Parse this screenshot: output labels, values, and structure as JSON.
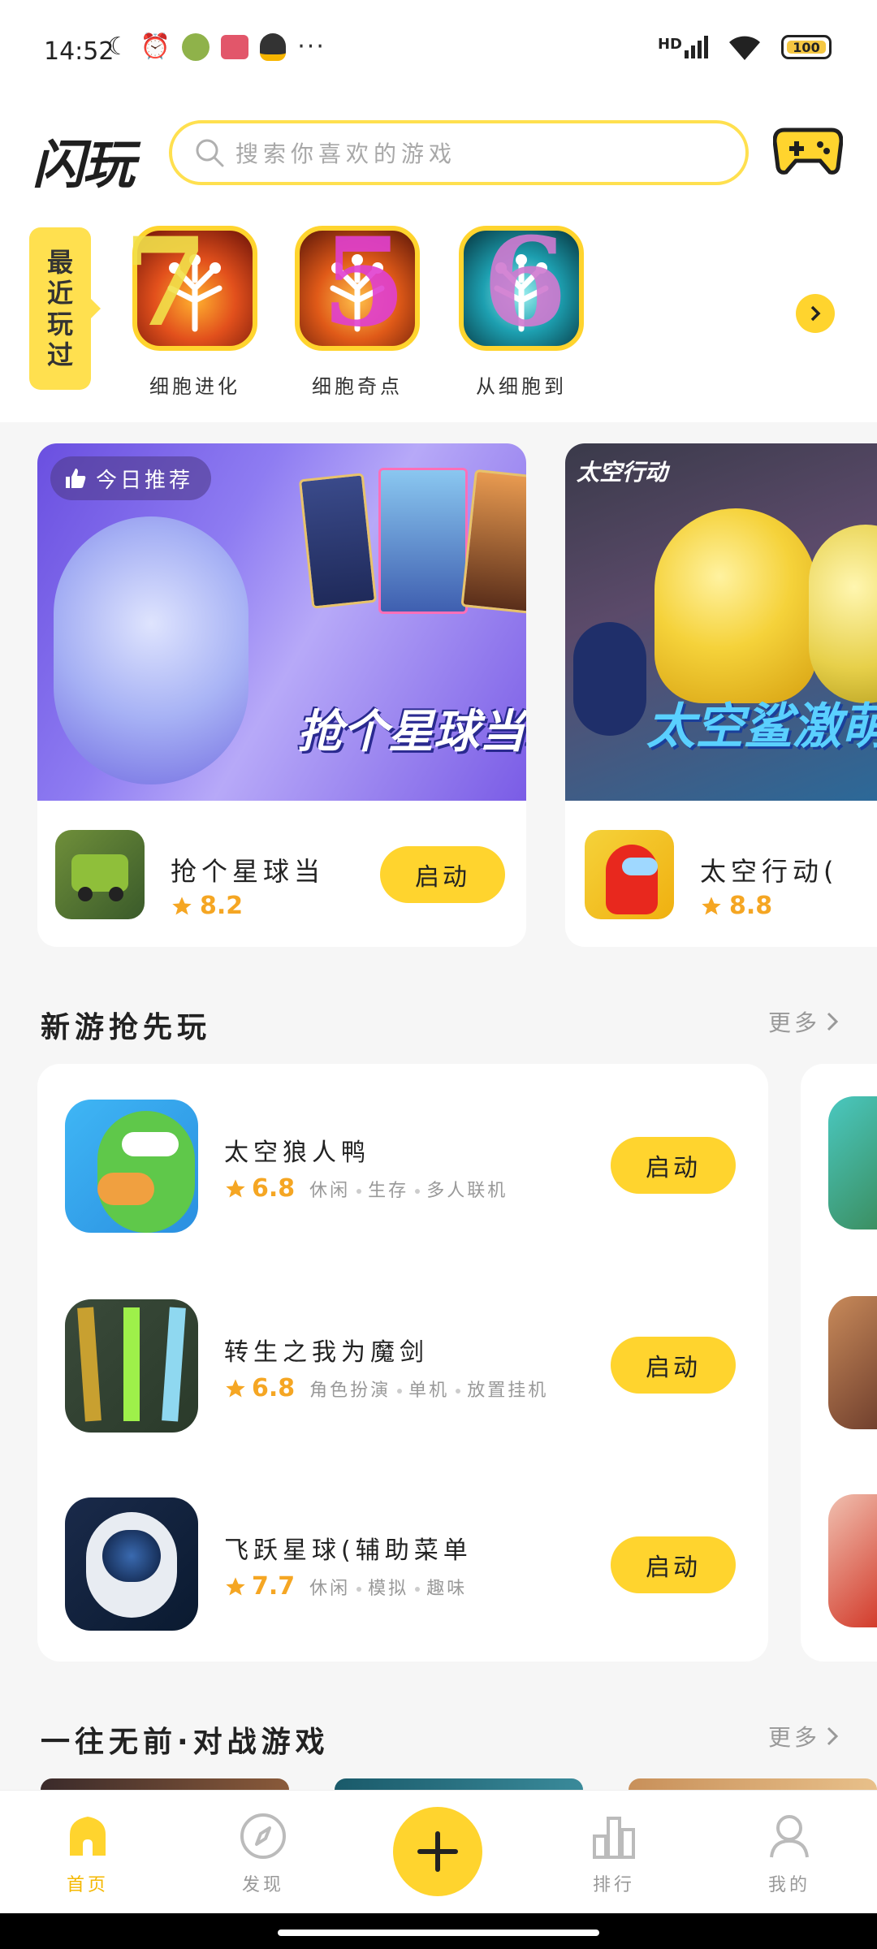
{
  "status_bar": {
    "time": "14:52",
    "hd": "HD",
    "dots": "···",
    "battery": "100"
  },
  "header": {
    "logo": "闪玩",
    "search_placeholder": "搜索你喜欢的游戏"
  },
  "recent": {
    "tag": [
      "最",
      "近",
      "玩",
      "过"
    ],
    "items": [
      {
        "name": "细胞进化",
        "number": "7"
      },
      {
        "name": "细胞奇点",
        "number": "5"
      },
      {
        "name": "从细胞到",
        "number": "6"
      }
    ]
  },
  "banners": [
    {
      "tag": "今日推荐",
      "overlay": "抢个星球当霸主",
      "title": "抢个星球当",
      "rating": "8.2",
      "button": "启动"
    },
    {
      "tag": "太空行动",
      "overlay": "太空鲨激萌",
      "title": "太空行动(",
      "rating": "8.8"
    }
  ],
  "new_games": {
    "title": "新游抢先玩",
    "more": "更多",
    "items": [
      {
        "title": "太空狼人鸭",
        "rating": "6.8",
        "tags": [
          "休闲",
          "生存",
          "多人联机"
        ],
        "button": "启动"
      },
      {
        "title": "转生之我为魔剑",
        "rating": "6.8",
        "tags": [
          "角色扮演",
          "单机",
          "放置挂机"
        ],
        "button": "启动"
      },
      {
        "title": "飞跃星球(辅助菜单",
        "rating": "7.7",
        "tags": [
          "休闲",
          "模拟",
          "趣味"
        ],
        "button": "启动"
      }
    ]
  },
  "battle_games": {
    "title": "一往无前·对战游戏",
    "more": "更多"
  },
  "bottom_nav": {
    "home": "首页",
    "discover": "发现",
    "rank": "排行",
    "mine": "我的"
  },
  "colors": {
    "accent": "#ffd42e",
    "rating": "#f5a623"
  }
}
